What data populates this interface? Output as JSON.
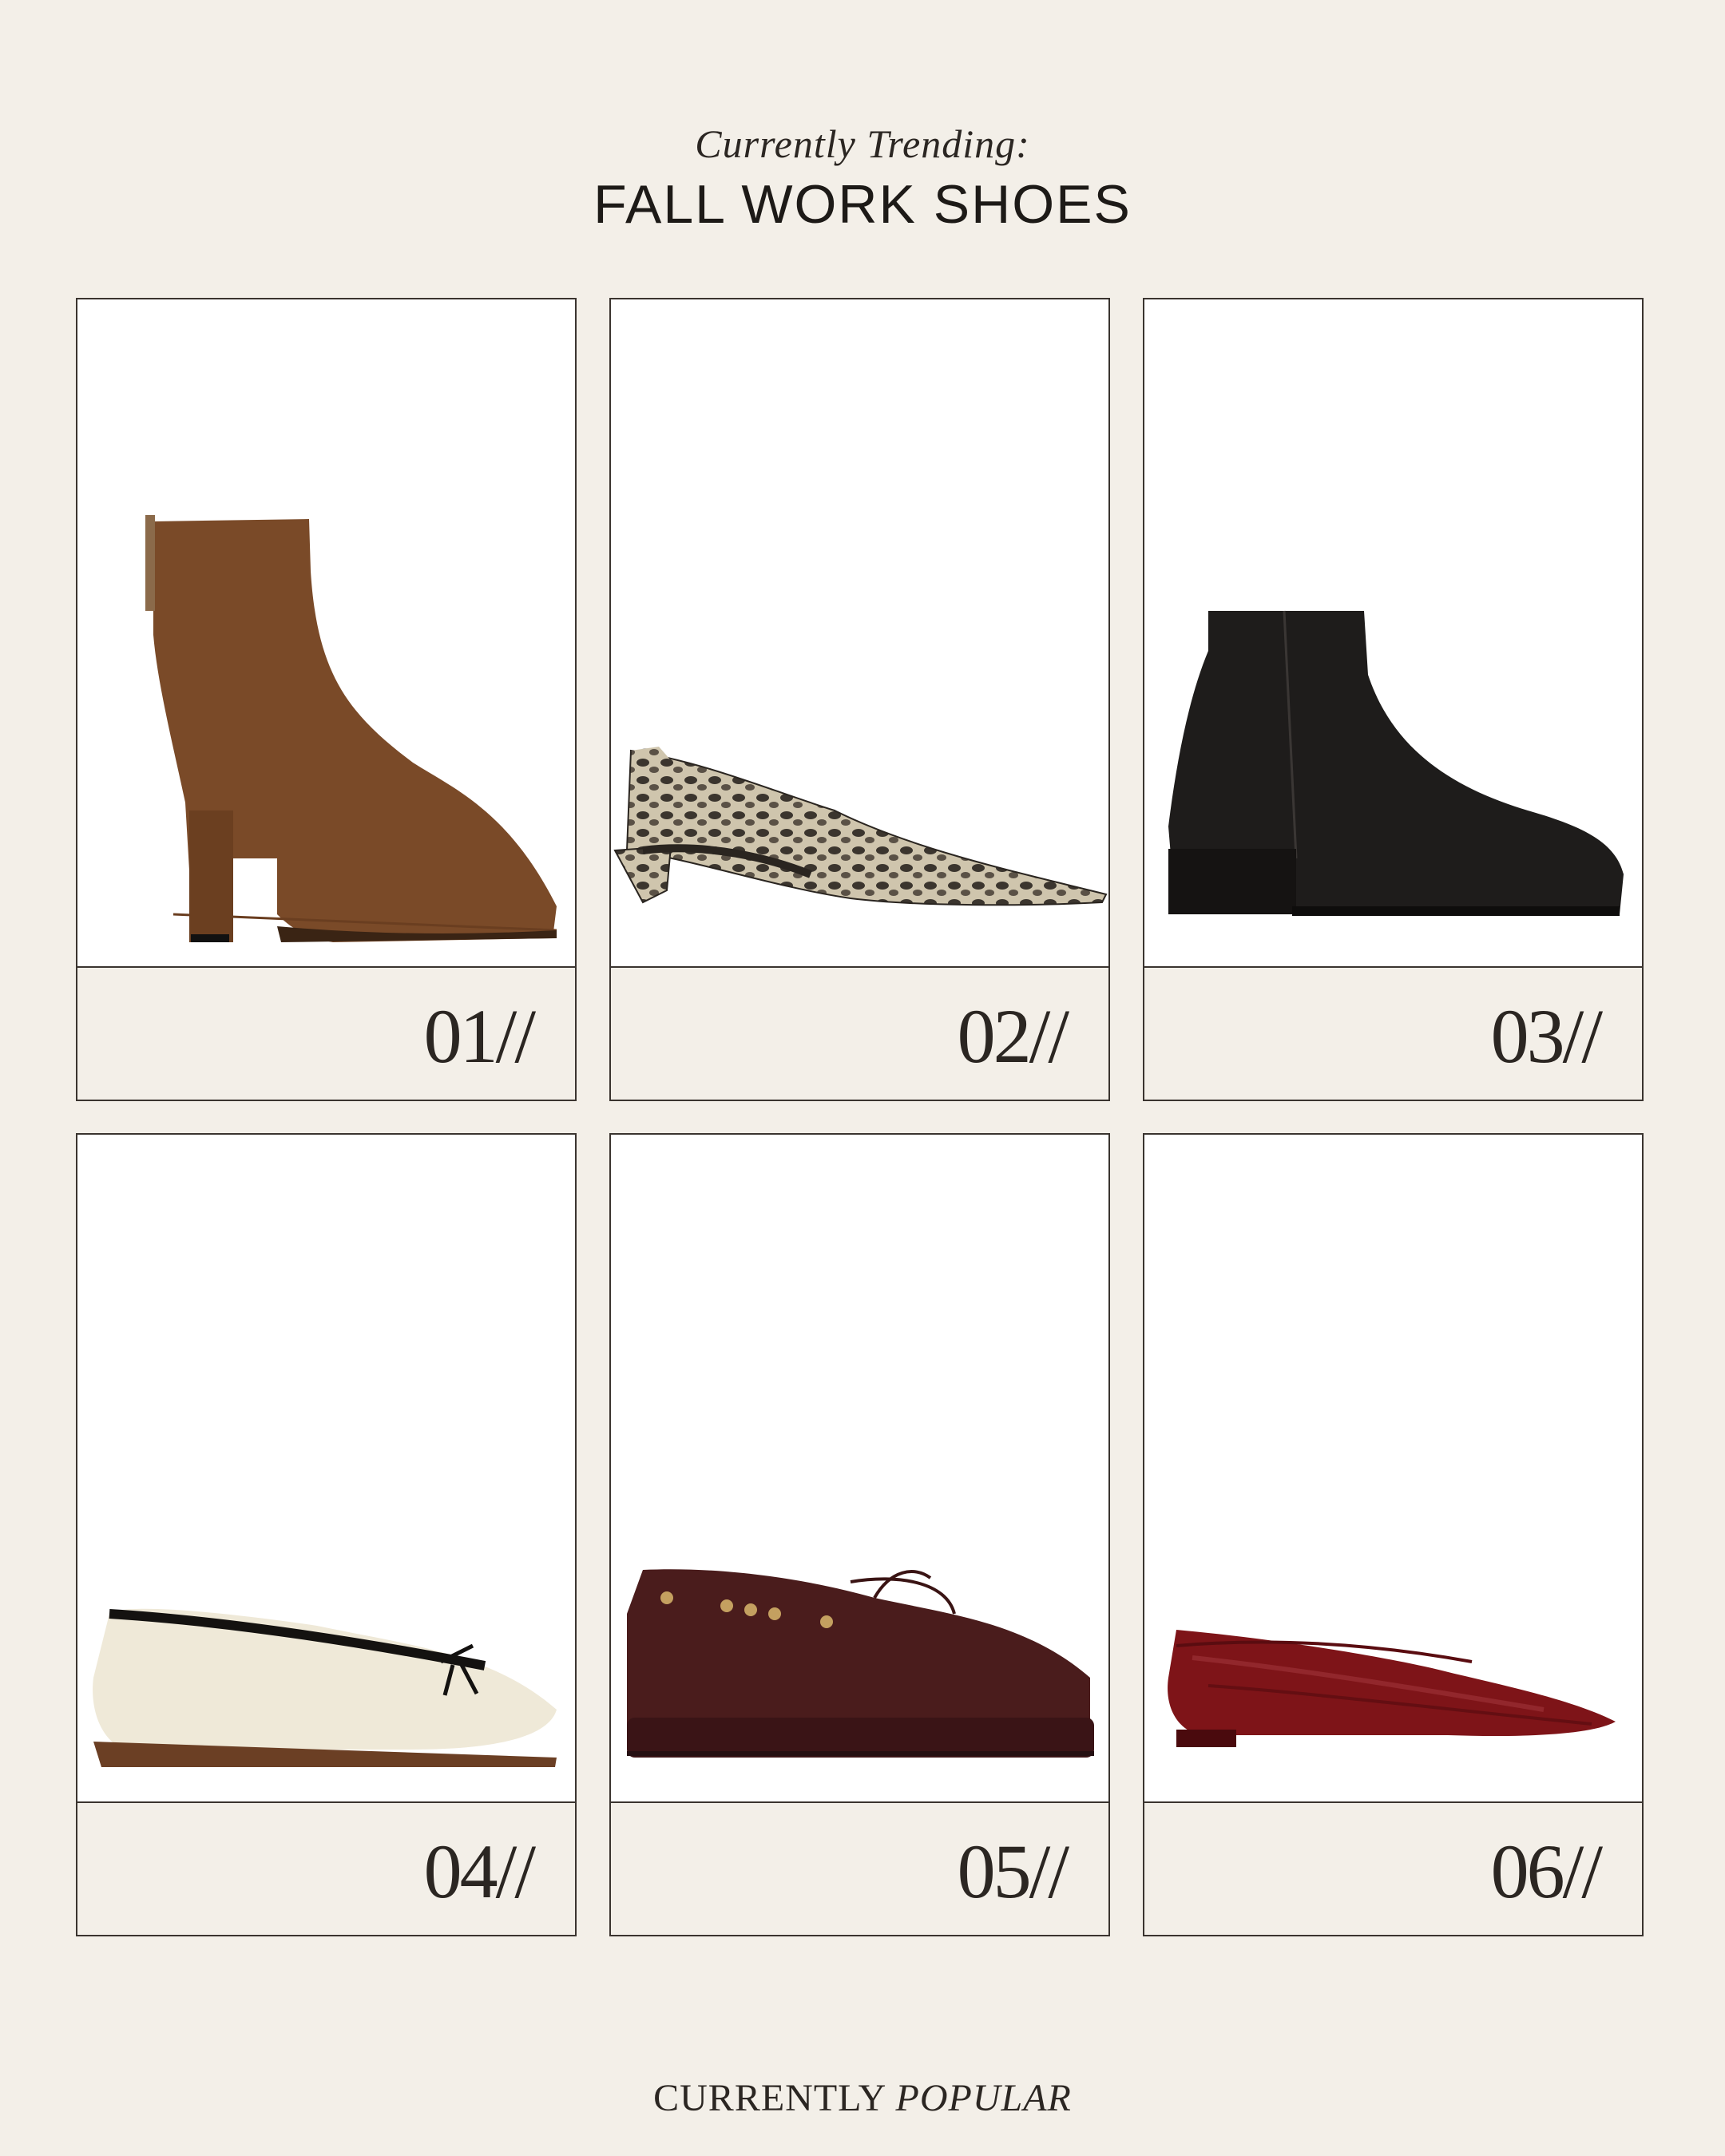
{
  "header": {
    "kicker": "Currently Trending:",
    "title": "FALL WORK SHOES"
  },
  "items": [
    {
      "number": "01//",
      "icon": "suede-ankle-boot-icon",
      "color": "#7a4a28"
    },
    {
      "number": "02//",
      "icon": "snakeskin-slingback-icon",
      "color": "#b7ad98"
    },
    {
      "number": "03//",
      "icon": "black-leather-boot-icon",
      "color": "#1e1c1b"
    },
    {
      "number": "04//",
      "icon": "cream-ballet-flat-icon",
      "color": "#efe9d8"
    },
    {
      "number": "05//",
      "icon": "burgundy-boat-shoe-icon",
      "color": "#4a1c1c"
    },
    {
      "number": "06//",
      "icon": "red-patent-flat-icon",
      "color": "#7e1418"
    }
  ],
  "footer": {
    "brand_a": "CURRENTLY",
    "brand_b": "POPULAR"
  }
}
